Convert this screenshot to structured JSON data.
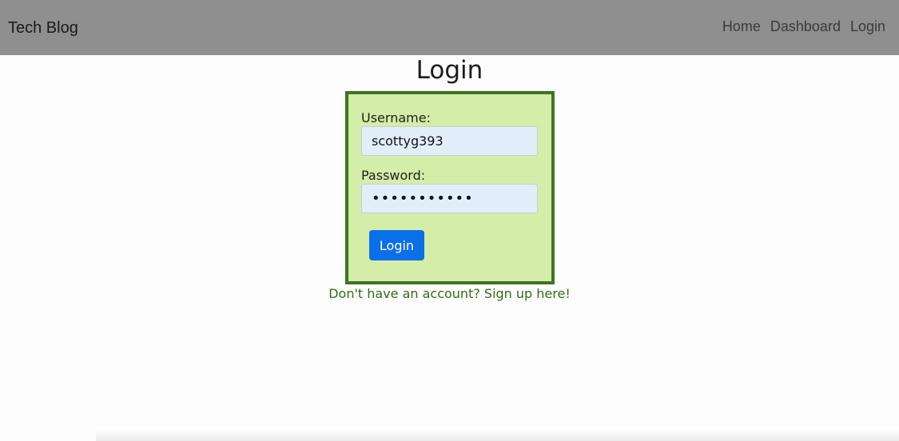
{
  "navbar": {
    "brand": "Tech Blog",
    "links": [
      {
        "label": "Home"
      },
      {
        "label": "Dashboard"
      },
      {
        "label": "Login"
      }
    ],
    "background_color": "#8f8f8f"
  },
  "page": {
    "title": "Login"
  },
  "login_form": {
    "username_label": "Username:",
    "username_value": "scottyg393",
    "password_label": "Password:",
    "password_value": "scottyg3933",
    "submit_label": "Login",
    "card_background": "#d4eda8",
    "card_border_color": "#3d7423",
    "button_color": "#0a6fe8"
  },
  "signup": {
    "text": "Don't have an account? Sign up here!"
  }
}
